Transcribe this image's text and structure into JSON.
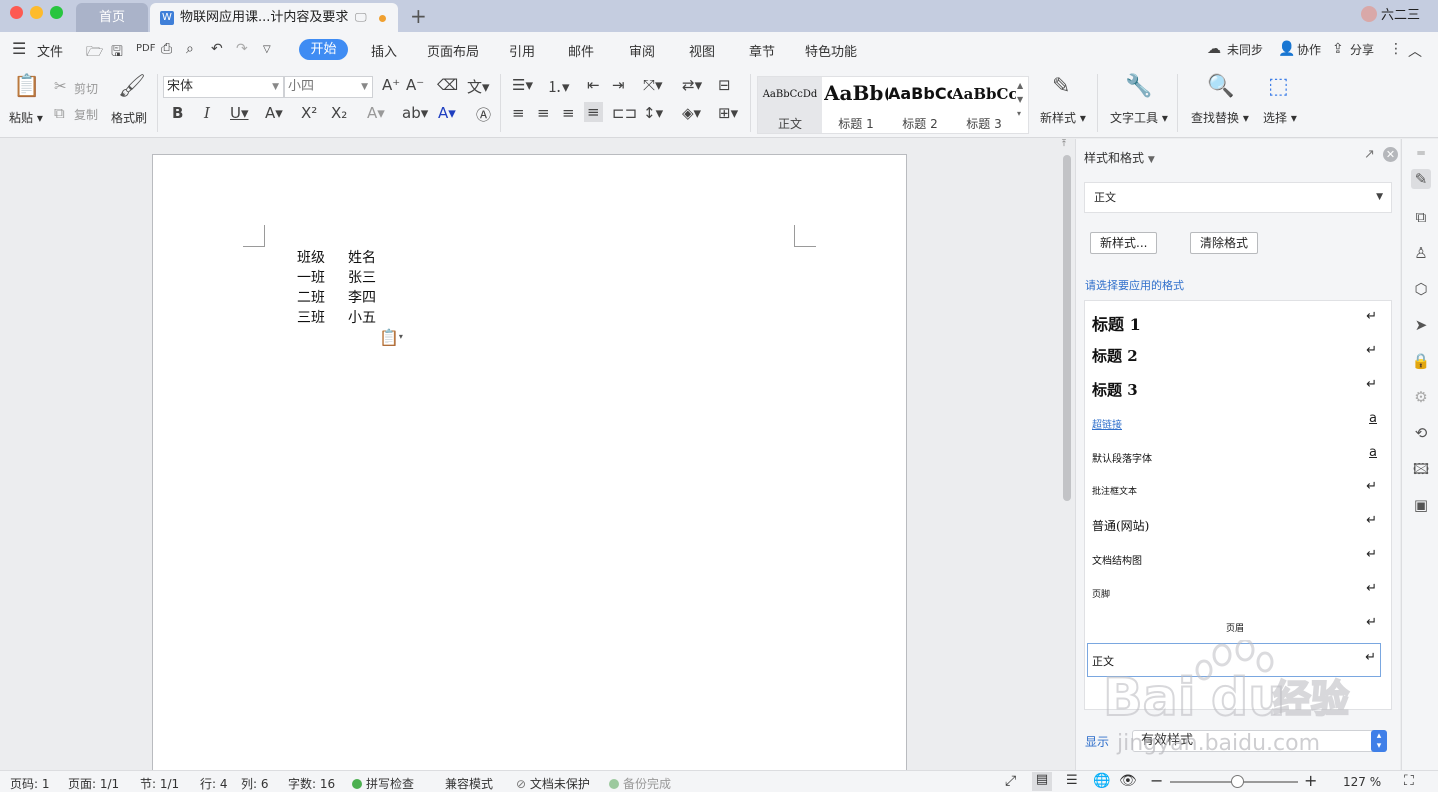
{
  "titlebar": {
    "home_tab": "首页",
    "doc_tab": "物联网应用课...计内容及要求",
    "add_tab": "+",
    "user_name": "六二三"
  },
  "menu": {
    "file": "文件",
    "tabs": [
      "开始",
      "插入",
      "页面布局",
      "引用",
      "邮件",
      "审阅",
      "视图",
      "章节",
      "特色功能"
    ],
    "sync": "未同步",
    "collab": "协作",
    "share": "分享"
  },
  "ribbon": {
    "paste": "粘贴",
    "cut": "剪切",
    "copy": "复制",
    "format_painter": "格式刷",
    "font_name": "宋体",
    "font_size": "小四",
    "styles": [
      {
        "preview": "AaBbCcDd",
        "name": "正文"
      },
      {
        "preview": "AaBb(",
        "name": "标题 1"
      },
      {
        "preview": "AaBbCc",
        "name": "标题 2"
      },
      {
        "preview": "AaBbCc",
        "name": "标题 3"
      }
    ],
    "new_style": "新样式",
    "text_tools": "文字工具",
    "find_replace": "查找替换",
    "select": "选择"
  },
  "document": {
    "rows": [
      [
        "班级",
        "姓名"
      ],
      [
        "一班",
        "张三"
      ],
      [
        "二班",
        "李四"
      ],
      [
        "三班",
        "小五"
      ]
    ]
  },
  "panel": {
    "title": "样式和格式",
    "current_style": "正文",
    "new_style_btn": "新样式...",
    "clear_format_btn": "清除格式",
    "prompt": "请选择要应用的格式",
    "styles": [
      {
        "name": "标题  1",
        "mark": "↵"
      },
      {
        "name": "标题  2",
        "mark": "↵"
      },
      {
        "name": "标题  3",
        "mark": "↵"
      },
      {
        "name": "超链接",
        "mark": "a"
      },
      {
        "name": "默认段落字体",
        "mark": "a"
      },
      {
        "name": "批注框文本",
        "mark": "↵"
      },
      {
        "name": "普通(网站)",
        "mark": "↵"
      },
      {
        "name": "文档结构图",
        "mark": "↵"
      },
      {
        "name": "页脚",
        "mark": "↵"
      },
      {
        "name": "页眉",
        "mark": "↵"
      },
      {
        "name": "正文",
        "mark": "↵"
      }
    ],
    "show_label": "显示",
    "show_value": "有效样式"
  },
  "status": {
    "page_no": "页码: 1",
    "pages": "页面: 1/1",
    "section": "节: 1/1",
    "row": "行: 4",
    "col": "列: 6",
    "words": "字数: 16",
    "spell": "拼写检查",
    "compat": "兼容模式",
    "protect": "文档未保护",
    "backup": "备份完成",
    "zoom": "127 %"
  },
  "watermark": {
    "brand": "Baidu经验",
    "url": "jingyan.baidu.com"
  },
  "colors": {
    "accent": "#3f8cf3",
    "titlebar": "#c5cde0",
    "link": "#2f6fcb"
  }
}
